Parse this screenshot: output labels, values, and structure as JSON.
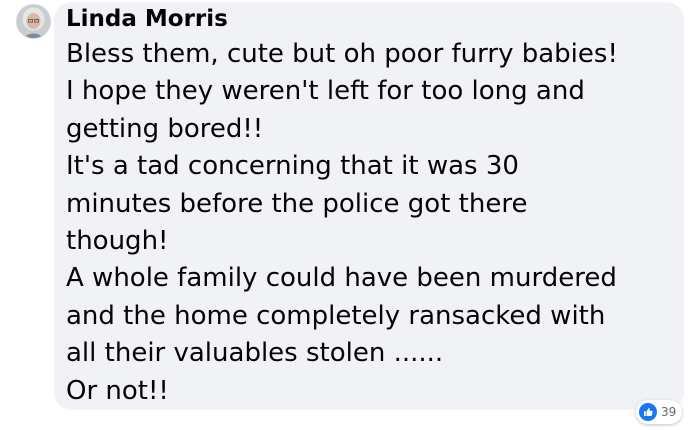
{
  "comment": {
    "author": "Linda Morris",
    "body_lines": [
      "Bless them, cute but oh poor furry babies!",
      "I hope they weren't left for too long and",
      "getting bored!!",
      "It's a tad concerning that it was 30",
      "minutes before the police got there",
      "though!",
      "A whole family could have been murdered",
      "and the home completely ransacked with",
      "all their valuables stolen ......",
      "Or not!!"
    ],
    "reactions": {
      "icon": "like-icon",
      "count": "39",
      "color": "#1877f2"
    }
  },
  "colors": {
    "bubble": "#f0f2f5",
    "text": "#050505",
    "muted": "#65676b"
  }
}
